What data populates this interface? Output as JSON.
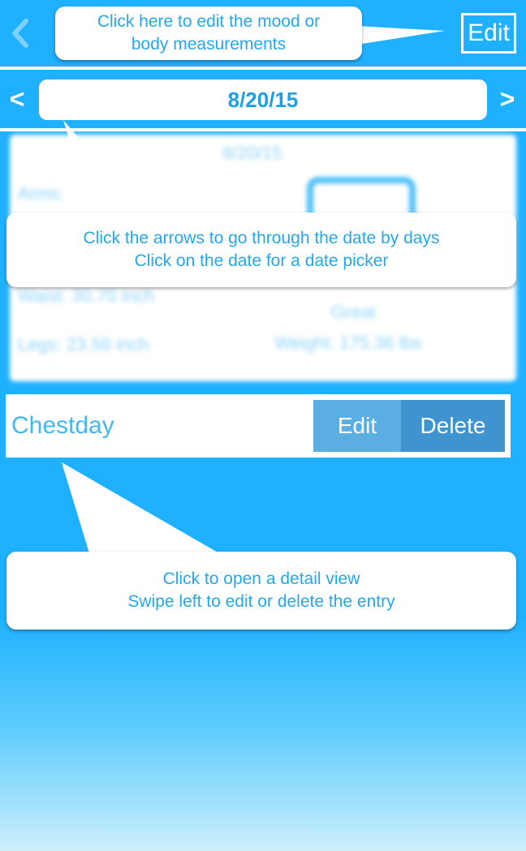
{
  "nav": {
    "back_icon": "chevron-left-icon",
    "edit_label": "Edit"
  },
  "date_bar": {
    "prev_label": "<",
    "next_label": ">",
    "date": "8/20/15"
  },
  "summary_card": {
    "date": "8/20/15",
    "arms_label": "Arms:",
    "waist": "Waist: 30.70 inch",
    "legs": "Legs: 23.50 inch",
    "mood": "Great",
    "weight": "Weight: 175.36 lbs"
  },
  "entry": {
    "name": "Chestday",
    "edit_label": "Edit",
    "delete_label": "Delete"
  },
  "tooltips": {
    "edit_hint_line1": "Click here to edit the mood or",
    "edit_hint_line2": "body measurements",
    "date_hint_line1": "Click the arrows to go through the date by days",
    "date_hint_line2": "Click on the date for a date picker",
    "entry_hint_line1": "Click to open a detail view",
    "entry_hint_line2": "Swipe left to edit or delete the entry"
  },
  "colors": {
    "background": "#1fb1ff",
    "accent_text": "#25a7ec",
    "edit_swipe": "#5aaee2",
    "delete_swipe": "#3f94d0"
  }
}
